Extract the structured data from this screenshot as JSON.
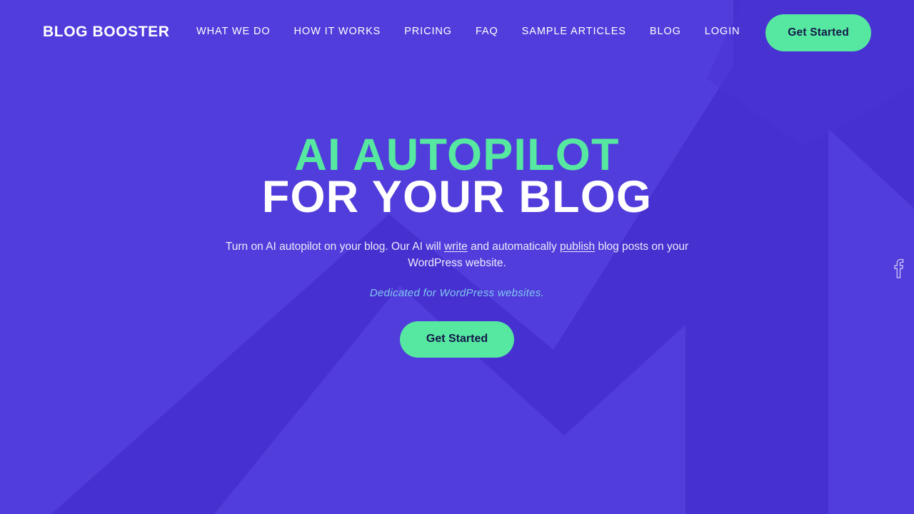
{
  "theme": {
    "bg_purple": "#513DDB",
    "arrow_purple": "#4630CF",
    "accent_green": "#56E8A0",
    "cta_text": "#14184a",
    "tagline_blue": "#7FC6F0",
    "text_white": "#FFFFFF"
  },
  "navbar": {
    "logo": "BLOG BOOSTER",
    "links": [
      {
        "label": "WHAT WE DO"
      },
      {
        "label": "HOW IT WORKS"
      },
      {
        "label": "PRICING"
      },
      {
        "label": "FAQ"
      },
      {
        "label": "SAMPLE ARTICLES"
      },
      {
        "label": "BLOG"
      },
      {
        "label": "LOGIN"
      }
    ],
    "cta_label": "Get Started"
  },
  "hero": {
    "headline_line1": "AI AUTOPILOT",
    "headline_line2": "FOR YOUR BLOG",
    "subtitle_part1": "Turn on AI autopilot on your blog. Our AI will ",
    "subtitle_link1": "write",
    "subtitle_part2": " and automatically ",
    "subtitle_link2": "publish",
    "subtitle_part3": " blog posts on your WordPress website.",
    "tagline": "Dedicated for WordPress websites.",
    "cta_label": "Get Started"
  },
  "social": {
    "items": [
      {
        "icon": "facebook-icon",
        "label": "Facebook"
      }
    ]
  }
}
